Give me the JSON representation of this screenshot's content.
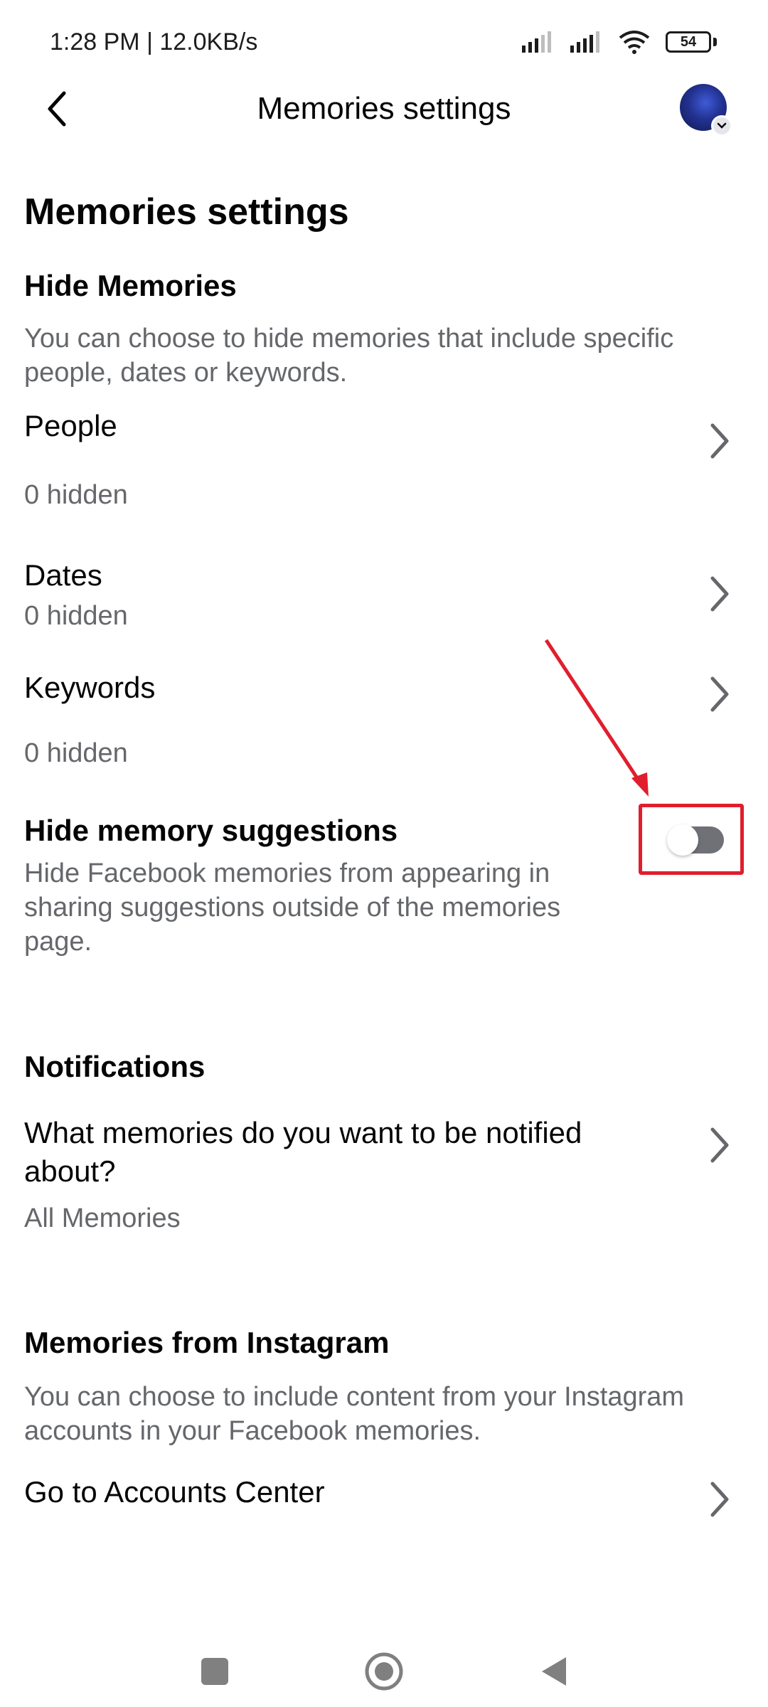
{
  "status_bar": {
    "time": "1:28 PM | 12.0KB/s",
    "battery": "54"
  },
  "header": {
    "title": "Memories settings",
    "back_icon": "back-arrow-icon",
    "avatar_icon": "profile-avatar"
  },
  "page": {
    "heading": "Memories settings"
  },
  "hide_memories": {
    "title": "Hide Memories",
    "description": "You can choose to hide memories that include specific people, dates or keywords.",
    "items": [
      {
        "label": "People",
        "sub": "0 hidden"
      },
      {
        "label": "Dates",
        "sub": "0 hidden"
      },
      {
        "label": "Keywords",
        "sub": "0 hidden"
      }
    ]
  },
  "hide_suggestions": {
    "label": "Hide memory suggestions",
    "description": "Hide Facebook memories from appearing in sharing suggestions outside of the memories page.",
    "toggle_on": false
  },
  "notifications": {
    "title": "Notifications",
    "question": "What memories do you want to be notified about?",
    "value": "All Memories"
  },
  "instagram": {
    "title": "Memories from Instagram",
    "description": "You can choose to include content from your Instagram accounts in your Facebook memories.",
    "link_label": "Go to Accounts Center"
  },
  "colors": {
    "annotation": "#e01e2d",
    "secondary_text": "#65676b",
    "toggle_track": "#6f7176"
  }
}
